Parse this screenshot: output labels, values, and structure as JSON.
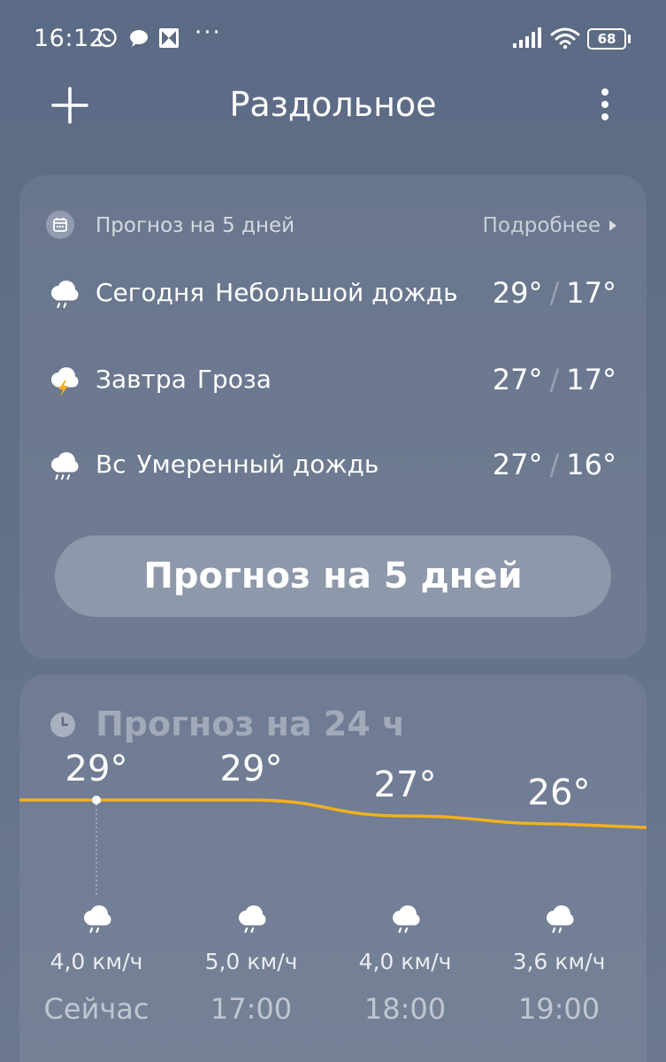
{
  "status_bar": {
    "time": "16:12",
    "battery": "68",
    "overflow_dots": "···"
  },
  "header": {
    "city": "Раздольное"
  },
  "forecast_5day": {
    "title": "Прогноз на 5 дней",
    "more_label": "Подробнее",
    "button_label": "Прогноз на 5 дней",
    "days": [
      {
        "day": "Сегодня",
        "condition": "Небольшой дождь",
        "high": "29°",
        "low": "17°",
        "icon": "light-rain-icon"
      },
      {
        "day": "Завтра",
        "condition": "Гроза",
        "high": "27°",
        "low": "17°",
        "icon": "thunderstorm-icon"
      },
      {
        "day": "Вс",
        "condition": "Умеренный дождь",
        "high": "27°",
        "low": "16°",
        "icon": "moderate-rain-icon"
      }
    ],
    "temp_separator": "/"
  },
  "forecast_24h": {
    "title": "Прогноз на 24 ч",
    "line_color": "#f2b01e",
    "hours": [
      {
        "time": "Сейчас",
        "temp_label": "29°",
        "temp": 29,
        "wind": "4,0 км/ч",
        "icon": "rain-icon"
      },
      {
        "time": "17:00",
        "temp_label": "29°",
        "temp": 29,
        "wind": "5,0 км/ч",
        "icon": "rain-icon"
      },
      {
        "time": "18:00",
        "temp_label": "27°",
        "temp": 27,
        "wind": "4,0 км/ч",
        "icon": "rain-icon"
      },
      {
        "time": "19:00",
        "temp_label": "26°",
        "temp": 26,
        "wind": "3,6 км/ч",
        "icon": "rain-icon"
      }
    ]
  }
}
